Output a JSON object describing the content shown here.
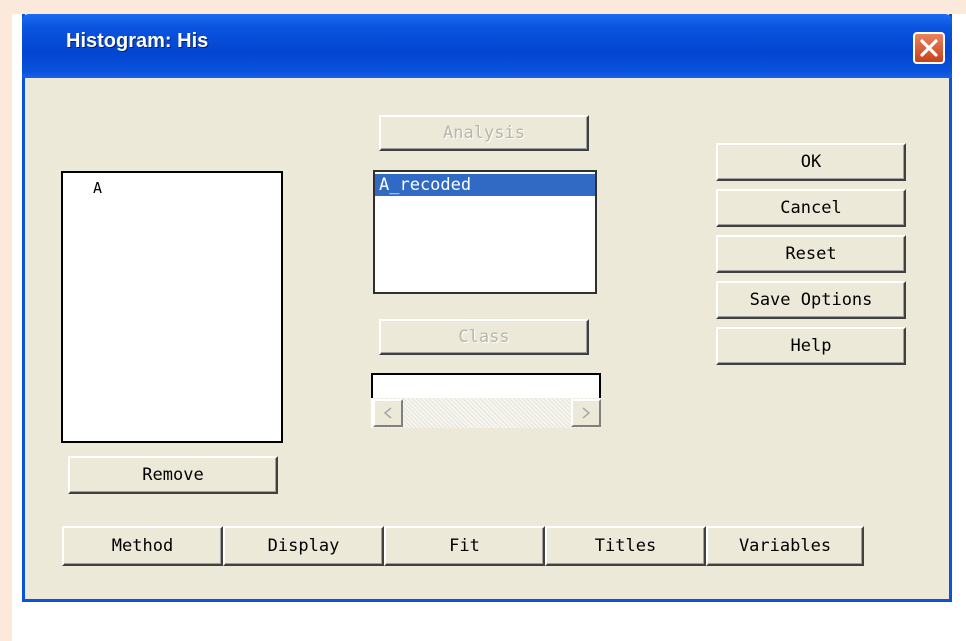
{
  "window": {
    "title": "Histogram: His"
  },
  "variables_list": {
    "items": [
      "A"
    ]
  },
  "analysis": {
    "label": "Analysis",
    "items": [
      "A_recoded"
    ]
  },
  "class": {
    "label": "Class",
    "value": ""
  },
  "remove_label": "Remove",
  "actions": {
    "ok": "OK",
    "cancel": "Cancel",
    "reset": "Reset",
    "save_options": "Save Options",
    "help": "Help"
  },
  "tabs": [
    "Method",
    "Display",
    "Fit",
    "Titles",
    "Variables"
  ],
  "colors": {
    "titlebar": "#0245d0",
    "dialog_bg": "#ece9d8",
    "selection": "#316ac5",
    "close_button": "#c8411a"
  }
}
